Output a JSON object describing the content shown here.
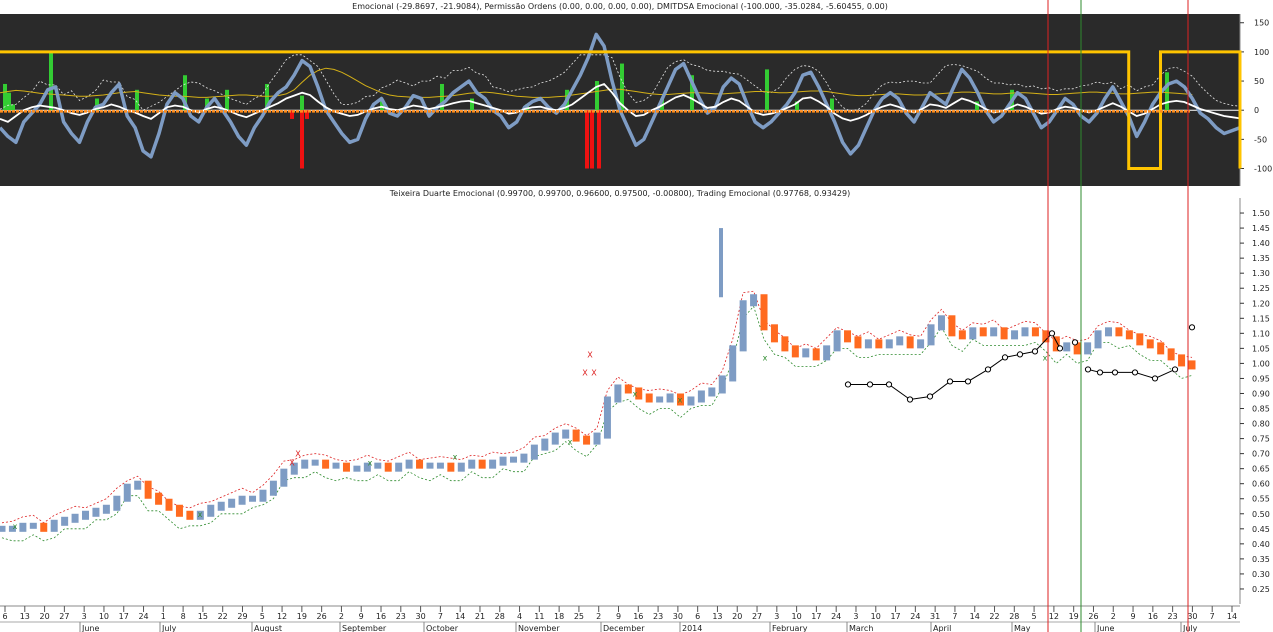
{
  "chart_data": [
    {
      "type": "line",
      "panel": "indicator",
      "title": "Emocional (-29.8697, -21.9084), Permissão Ordens (0.00, 0.00, 0.00, 0.00), DMITDSA Emocional (-100.000, -35.0284, -5.60455, 0.00)",
      "ylim": [
        -130,
        165
      ],
      "yticks": [
        150,
        100,
        50,
        0,
        -50,
        -100
      ],
      "zero_line": 0,
      "colors": {
        "background": "#2a2a2a",
        "emocional": "#7e9cc4",
        "white_line": "#ffffff",
        "yellow_line": "#d4b017",
        "dashed": "#e8e8e8",
        "permissao": "#ffc400",
        "buy_bar": "#33cc33",
        "sell_bar": "#ee1111"
      },
      "series": [
        {
          "key": "emocional",
          "values": [
            -30,
            -45,
            -55,
            -20,
            -5,
            10,
            35,
            40,
            -20,
            -40,
            -55,
            -20,
            5,
            10,
            30,
            45,
            -10,
            -30,
            -70,
            -80,
            -40,
            10,
            30,
            20,
            -10,
            -20,
            5,
            20,
            0,
            -20,
            -45,
            -60,
            -30,
            -10,
            15,
            30,
            40,
            60,
            85,
            75,
            40,
            0,
            -20,
            -40,
            -55,
            -50,
            -15,
            10,
            20,
            -5,
            -10,
            5,
            25,
            20,
            -10,
            5,
            15,
            30,
            40,
            50,
            30,
            20,
            0,
            -10,
            -30,
            -20,
            5,
            15,
            20,
            5,
            -5,
            10,
            35,
            60,
            90,
            130,
            110,
            50,
            0,
            -30,
            -60,
            -50,
            -20,
            10,
            40,
            70,
            80,
            50,
            20,
            -5,
            5,
            40,
            55,
            45,
            10,
            -20,
            -30,
            -20,
            -5,
            10,
            30,
            60,
            65,
            40,
            10,
            -20,
            -55,
            -75,
            -60,
            -30,
            0,
            20,
            30,
            20,
            -5,
            -20,
            5,
            30,
            20,
            10,
            40,
            70,
            55,
            30,
            0,
            -20,
            -10,
            10,
            30,
            20,
            -5,
            -30,
            -20,
            0,
            20,
            10,
            -10,
            -20,
            -5,
            20,
            40,
            15,
            -10,
            -45,
            -20,
            10,
            30,
            45,
            50,
            40,
            20,
            -5,
            -15,
            -30,
            -40,
            -35,
            -30
          ]
        },
        {
          "key": "white_line",
          "values": [
            -15,
            -20,
            -10,
            0,
            5,
            8,
            6,
            4,
            0,
            -5,
            -8,
            -4,
            2,
            5,
            10,
            6,
            0,
            -4,
            -10,
            -15,
            -5,
            5,
            8,
            6,
            0,
            -4,
            2,
            6,
            3,
            -2,
            -8,
            -12,
            -6,
            0,
            6,
            12,
            20,
            25,
            30,
            26,
            15,
            5,
            -2,
            -6,
            -10,
            -8,
            -2,
            3,
            6,
            2,
            0,
            4,
            8,
            6,
            2,
            5,
            8,
            12,
            15,
            16,
            12,
            8,
            4,
            0,
            -6,
            -4,
            2,
            5,
            6,
            2,
            0,
            4,
            10,
            20,
            30,
            40,
            45,
            30,
            12,
            0,
            -10,
            -8,
            0,
            6,
            14,
            22,
            26,
            20,
            12,
            4,
            6,
            14,
            20,
            16,
            6,
            -4,
            -8,
            -6,
            -2,
            4,
            10,
            20,
            22,
            15,
            6,
            -6,
            -14,
            -18,
            -14,
            -8,
            0,
            6,
            10,
            6,
            0,
            -4,
            2,
            10,
            8,
            4,
            12,
            20,
            16,
            10,
            2,
            -4,
            -2,
            4,
            10,
            6,
            0,
            -6,
            -4,
            2,
            6,
            4,
            0,
            -4,
            0,
            6,
            12,
            6,
            -2,
            -10,
            -6,
            2,
            10,
            14,
            16,
            14,
            8,
            2,
            -2,
            -6,
            -10,
            -12,
            -14
          ]
        },
        {
          "key": "yellow_line",
          "values": [
            30,
            32,
            34,
            33,
            31,
            29,
            28,
            27,
            26,
            25,
            24,
            24,
            25,
            26,
            28,
            30,
            31,
            32,
            30,
            28,
            26,
            25,
            24,
            24,
            23,
            22,
            22,
            23,
            24,
            25,
            26,
            26,
            25,
            24,
            24,
            25,
            28,
            35,
            48,
            60,
            68,
            72,
            70,
            65,
            58,
            50,
            42,
            36,
            30,
            26,
            24,
            23,
            22,
            22,
            22,
            23,
            24,
            25,
            27,
            29,
            30,
            31,
            30,
            28,
            26,
            24,
            23,
            22,
            22,
            22,
            23,
            24,
            26,
            28,
            30,
            32,
            34,
            36,
            36,
            34,
            32,
            30,
            28,
            27,
            27,
            28,
            29,
            30,
            30,
            29,
            28,
            28,
            29,
            30,
            31,
            32,
            32,
            31,
            30,
            30,
            31,
            32,
            33,
            33,
            32,
            30,
            28,
            26,
            25,
            25,
            26,
            27,
            28,
            28,
            27,
            26,
            26,
            27,
            28,
            29,
            30,
            31,
            31,
            30,
            29,
            28,
            28,
            29,
            30,
            30,
            29,
            28,
            27,
            27,
            28,
            29,
            30,
            31,
            31,
            30,
            29,
            28,
            28,
            29,
            30,
            31,
            31,
            30,
            29,
            28,
            27
          ]
        },
        {
          "key": "permissao",
          "values": [
            100,
            100,
            100,
            100,
            100,
            100,
            100,
            100,
            100,
            100,
            100,
            100,
            100,
            100,
            100,
            100,
            100,
            100,
            100,
            100,
            100,
            100,
            100,
            100,
            100,
            100,
            100,
            100,
            100,
            100,
            100,
            100,
            100,
            100,
            100,
            100,
            100,
            100,
            100,
            100,
            100,
            100,
            100,
            100,
            100,
            100,
            100,
            100,
            100,
            100,
            100,
            100,
            100,
            100,
            100,
            100,
            100,
            100,
            100,
            100,
            100,
            100,
            100,
            100,
            100,
            100,
            100,
            100,
            100,
            100,
            100,
            100,
            100,
            100,
            100,
            100,
            100,
            100,
            100,
            100,
            100,
            100,
            100,
            100,
            100,
            100,
            100,
            100,
            100,
            100,
            100,
            100,
            100,
            100,
            100,
            100,
            100,
            100,
            100,
            100,
            100,
            100,
            100,
            100,
            100,
            100,
            100,
            100,
            100,
            100,
            100,
            100,
            100,
            100,
            100,
            100,
            100,
            100,
            100,
            100,
            100,
            100,
            100,
            100,
            100,
            100,
            100,
            100,
            100,
            100,
            100,
            100,
            100,
            100,
            100,
            100,
            100,
            100,
            100,
            100,
            100,
            100,
            -100,
            -100,
            -100,
            -100,
            100,
            100,
            100,
            100,
            100,
            100,
            100,
            100,
            100,
            100,
            -100
          ]
        }
      ],
      "buy_bars": [
        [
          3,
          45
        ],
        [
          7,
          30
        ],
        [
          11,
          10
        ],
        [
          49,
          100
        ],
        [
          95,
          20
        ],
        [
          135,
          35
        ],
        [
          183,
          60
        ],
        [
          205,
          20
        ],
        [
          225,
          35
        ],
        [
          265,
          45
        ],
        [
          300,
          25
        ],
        [
          380,
          15
        ],
        [
          440,
          45
        ],
        [
          470,
          20
        ],
        [
          525,
          10
        ],
        [
          565,
          35
        ],
        [
          595,
          50
        ],
        [
          620,
          80
        ],
        [
          660,
          20
        ],
        [
          690,
          60
        ],
        [
          765,
          70
        ],
        [
          795,
          15
        ],
        [
          830,
          20
        ],
        [
          975,
          15
        ],
        [
          1010,
          35
        ],
        [
          1165,
          65
        ]
      ],
      "sell_bars": [
        [
          290,
          -15
        ],
        [
          300,
          -100
        ],
        [
          305,
          -15
        ],
        [
          585,
          -100
        ],
        [
          590,
          -100
        ],
        [
          597,
          -100
        ]
      ]
    },
    {
      "type": "line",
      "panel": "price",
      "title": "Teixeira Duarte Emocional (0.99700, 0.99700, 0.96600, 0.97500, -0.00800), Trading Emocional (0.97768, 0.93429)",
      "ylim": [
        0.2,
        1.55
      ],
      "yticks": [
        1.5,
        1.45,
        1.4,
        1.35,
        1.3,
        1.25,
        1.2,
        1.15,
        1.1,
        1.05,
        1.0,
        0.95,
        0.9,
        0.85,
        0.8,
        0.75,
        0.7,
        0.65,
        0.6,
        0.55,
        0.5,
        0.45,
        0.4,
        0.35,
        0.3,
        0.25
      ],
      "colors": {
        "bar_up": "#7e9cc4",
        "bar_down": "#ff6a1f",
        "dashed_green": "#2e8b2e",
        "dashed_red": "#dd2222",
        "x_marker_green": "#2e8b2e",
        "x_marker_red": "#dd2222",
        "circle_line": "#000000"
      },
      "close": [
        0.45,
        0.45,
        0.46,
        0.46,
        0.45,
        0.47,
        0.48,
        0.49,
        0.5,
        0.51,
        0.52,
        0.55,
        0.59,
        0.6,
        0.56,
        0.54,
        0.52,
        0.5,
        0.49,
        0.5,
        0.52,
        0.53,
        0.54,
        0.55,
        0.55,
        0.57,
        0.6,
        0.64,
        0.66,
        0.67,
        0.67,
        0.66,
        0.66,
        0.65,
        0.65,
        0.66,
        0.66,
        0.65,
        0.66,
        0.67,
        0.66,
        0.66,
        0.66,
        0.65,
        0.66,
        0.67,
        0.66,
        0.67,
        0.68,
        0.68,
        0.69,
        0.72,
        0.74,
        0.76,
        0.77,
        0.75,
        0.74,
        0.76,
        0.88,
        0.92,
        0.91,
        0.89,
        0.88,
        0.88,
        0.89,
        0.87,
        0.88,
        0.9,
        0.91,
        0.95,
        1.05,
        1.2,
        1.22,
        1.12,
        1.08,
        1.05,
        1.03,
        1.04,
        1.02,
        1.05,
        1.1,
        1.08,
        1.06,
        1.07,
        1.06,
        1.07,
        1.08,
        1.06,
        1.07,
        1.12,
        1.15,
        1.1,
        1.09,
        1.11,
        1.1,
        1.11,
        1.09,
        1.1,
        1.11,
        1.1,
        1.08,
        1.05,
        1.06,
        1.04,
        1.06,
        1.1,
        1.11,
        1.1,
        1.09,
        1.07,
        1.06,
        1.04,
        1.02,
        1.0,
        0.99
      ],
      "circle_line": {
        "values": [
          [
            848,
            0.93
          ],
          [
            870,
            0.93
          ],
          [
            889,
            0.93
          ],
          [
            910,
            0.88
          ],
          [
            930,
            0.89
          ],
          [
            950,
            0.94
          ],
          [
            968,
            0.94
          ],
          [
            988,
            0.98
          ],
          [
            1005,
            1.02
          ],
          [
            1020,
            1.03
          ],
          [
            1035,
            1.04
          ],
          [
            1052,
            1.1
          ],
          [
            1060,
            1.05
          ],
          [
            1075,
            1.07
          ],
          [
            1088,
            0.98
          ],
          [
            1100,
            0.97
          ],
          [
            1115,
            0.97
          ],
          [
            1135,
            0.97
          ],
          [
            1155,
            0.95
          ],
          [
            1175,
            0.98
          ],
          [
            1192,
            1.12
          ]
        ]
      },
      "x_markers_green": [
        [
          15,
          0.46
        ],
        [
          200,
          0.5
        ],
        [
          370,
          0.67
        ],
        [
          455,
          0.69
        ],
        [
          570,
          0.74
        ],
        [
          635,
          0.9
        ],
        [
          680,
          0.88
        ],
        [
          765,
          1.02
        ],
        [
          1045,
          1.02
        ]
      ],
      "x_markers_red": [
        [
          298,
          0.7
        ],
        [
          292,
          0.67
        ],
        [
          590,
          1.03
        ],
        [
          585,
          0.97
        ],
        [
          594,
          0.97
        ]
      ],
      "xtick_labels": [
        "6",
        "13",
        "20",
        "27",
        "3",
        "10",
        "17",
        "24",
        "1",
        "8",
        "15",
        "22",
        "29",
        "5",
        "12",
        "19",
        "26",
        "2",
        "9",
        "16",
        "23",
        "30",
        "7",
        "14",
        "21",
        "28",
        "4",
        "11",
        "18",
        "25",
        "2",
        "9",
        "16",
        "23",
        "30",
        "6",
        "13",
        "20",
        "27",
        "3",
        "10",
        "17",
        "24",
        "3",
        "10",
        "17",
        "24",
        "31",
        "7",
        "14",
        "22",
        "28",
        "5",
        "12",
        "19",
        "26",
        "2",
        "9",
        "16",
        "23",
        "30",
        "7",
        "14"
      ],
      "month_labels": [
        "June",
        "July",
        "August",
        "September",
        "October",
        "November",
        "December",
        "2014",
        "February",
        "March",
        "April",
        "May",
        "June",
        "July"
      ],
      "vertical_lines": [
        {
          "x_label": "12",
          "color": "#dd2222"
        },
        {
          "x_label": "26",
          "color": "#2e8b2e"
        },
        {
          "x_label": "30",
          "color": "#dd2222"
        }
      ]
    }
  ]
}
